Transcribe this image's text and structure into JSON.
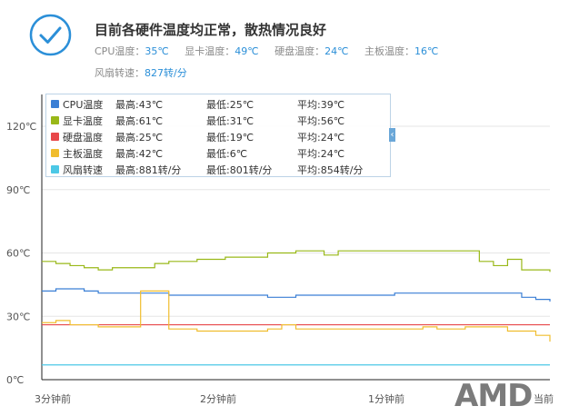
{
  "status": {
    "title": "目前各硬件温度均正常，散热情况良好",
    "temps": [
      {
        "label": "CPU温度：",
        "value": "35℃"
      },
      {
        "label": "显卡温度：",
        "value": "49℃"
      },
      {
        "label": "硬盘温度：",
        "value": "24℃"
      },
      {
        "label": "主板温度：",
        "value": "16℃"
      }
    ],
    "fan": {
      "label": "风扇转速：",
      "value": "827转/分"
    }
  },
  "legend": [
    {
      "name": "CPU温度",
      "max": "最高:43℃",
      "min": "最低:25℃",
      "avg": "平均:39℃",
      "color": "#3a7fd5"
    },
    {
      "name": "显卡温度",
      "max": "最高:61℃",
      "min": "最低:31℃",
      "avg": "平均:56℃",
      "color": "#99b818"
    },
    {
      "name": "硬盘温度",
      "max": "最高:25℃",
      "min": "最低:19℃",
      "avg": "平均:24℃",
      "color": "#e8484a"
    },
    {
      "name": "主板温度",
      "max": "最高:42℃",
      "min": "最低:6℃",
      "avg": "平均:24℃",
      "color": "#f0bd2e"
    },
    {
      "name": "风扇转速",
      "max": "最高:881转/分",
      "min": "最低:801转/分",
      "avg": "平均:854转/分",
      "color": "#4cc8e6"
    }
  ],
  "logo": "AMD",
  "chart_data": {
    "type": "line",
    "ylim": [
      0,
      120
    ],
    "y_ticks": [
      "0℃",
      "30℃",
      "60℃",
      "90℃",
      "120℃"
    ],
    "x_ticks": [
      "3分钟前",
      "2分钟前",
      "1分钟前",
      "当前"
    ],
    "x": [
      0,
      5,
      10,
      15,
      20,
      25,
      30,
      35,
      40,
      45,
      50,
      55,
      60,
      65,
      70,
      75,
      80,
      85,
      90,
      95,
      100,
      105,
      110,
      115,
      120,
      125,
      130,
      135,
      140,
      145,
      150,
      155,
      160,
      165,
      170,
      175,
      180
    ],
    "series": [
      {
        "name": "CPU温度",
        "color": "#3a7fd5",
        "values": [
          42,
          43,
          43,
          42,
          41,
          41,
          41,
          41,
          41,
          40,
          40,
          40,
          40,
          40,
          40,
          40,
          39,
          39,
          40,
          40,
          40,
          40,
          40,
          40,
          40,
          41,
          41,
          41,
          41,
          41,
          41,
          41,
          41,
          41,
          39,
          38,
          37
        ]
      },
      {
        "name": "显卡温度",
        "color": "#99b818",
        "values": [
          56,
          55,
          54,
          53,
          52,
          53,
          53,
          53,
          55,
          56,
          56,
          57,
          57,
          58,
          58,
          58,
          60,
          60,
          61,
          61,
          59,
          61,
          61,
          61,
          61,
          61,
          61,
          61,
          61,
          61,
          61,
          56,
          54,
          57,
          52,
          52,
          51
        ]
      },
      {
        "name": "硬盘温度",
        "color": "#e8484a",
        "values": [
          26,
          26,
          26,
          26,
          26,
          26,
          26,
          26,
          26,
          26,
          26,
          26,
          26,
          26,
          26,
          26,
          26,
          26,
          26,
          26,
          26,
          26,
          26,
          26,
          26,
          26,
          26,
          26,
          26,
          26,
          26,
          26,
          26,
          26,
          26,
          26,
          26
        ]
      },
      {
        "name": "主板温度",
        "color": "#f0bd2e",
        "values": [
          27,
          28,
          26,
          26,
          25,
          25,
          25,
          42,
          42,
          24,
          24,
          23,
          23,
          23,
          23,
          23,
          24,
          26,
          24,
          24,
          24,
          24,
          24,
          24,
          24,
          24,
          24,
          25,
          24,
          24,
          25,
          25,
          25,
          23,
          23,
          21,
          18
        ]
      },
      {
        "name": "风扇转速",
        "color": "#4cc8e6",
        "values": [
          7,
          7,
          7,
          7,
          7,
          7,
          7,
          7,
          7,
          7,
          7,
          7,
          7,
          7,
          7,
          7,
          7,
          7,
          7,
          7,
          7,
          7,
          7,
          7,
          7,
          7,
          7,
          7,
          7,
          7,
          7,
          7,
          7,
          7,
          7,
          7,
          7
        ]
      }
    ]
  }
}
